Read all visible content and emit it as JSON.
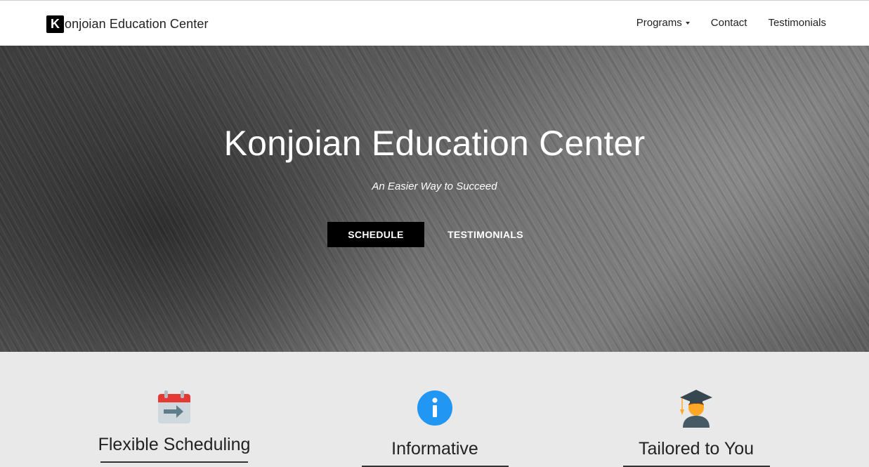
{
  "brand": {
    "logo_letter": "K",
    "name": "onjoian Education Center"
  },
  "nav": {
    "programs": "Programs",
    "contact": "Contact",
    "testimonials": "Testimonials"
  },
  "hero": {
    "title": "Konjoian Education Center",
    "tagline": "An Easier Way to Succeed",
    "schedule_button": "SCHEDULE",
    "testimonials_button": "TESTIMONIALS"
  },
  "features": [
    {
      "icon": "calendar-icon",
      "title": "Flexible Scheduling"
    },
    {
      "icon": "info-icon",
      "title": "Informative"
    },
    {
      "icon": "graduate-icon",
      "title": "Tailored to You"
    }
  ]
}
